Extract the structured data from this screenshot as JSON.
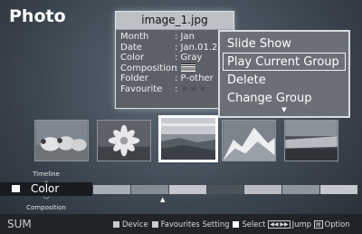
{
  "screen": {
    "title": "Photo"
  },
  "info_panel": {
    "filename": "image_1.jpg",
    "fields": [
      {
        "label": "Month",
        "value": ": Jan"
      },
      {
        "label": "Date",
        "value": ": Jan.01.2"
      },
      {
        "label": "Color",
        "value": ": Gray"
      },
      {
        "label": "Composition",
        "value": ":"
      },
      {
        "label": "Folder",
        "value": ": P-other"
      },
      {
        "label": "Favourite",
        "value": ":"
      }
    ],
    "favourite_stars": "★★★"
  },
  "menu": {
    "items": [
      {
        "label": "Slide Show",
        "selected": false
      },
      {
        "label": "Play Current Group",
        "selected": true
      },
      {
        "label": "Delete",
        "selected": false
      },
      {
        "label": "Change Group",
        "selected": false
      }
    ],
    "more_indicator": "▼"
  },
  "thumbnails": [
    {
      "icon": "sheep-photo",
      "selected": false
    },
    {
      "icon": "flower-photo",
      "selected": false
    },
    {
      "icon": "coast-photo",
      "selected": true
    },
    {
      "icon": "mountain-photo",
      "selected": false
    },
    {
      "icon": "landscape-photo",
      "selected": false
    }
  ],
  "sort_bar": {
    "prev_label": "Timeline",
    "current_label": "Color",
    "next_label": "Composition",
    "up_arrow": "︿",
    "down_arrow": "﹀",
    "position_marker": "▲",
    "segment_colors": [
      "#a9aeb4",
      "#868c93",
      "#c3c7cc",
      "#4d535b",
      "#b9bdc2",
      "#8f959c",
      "#c4c8cd"
    ]
  },
  "bottom_bar": {
    "sum_label": "SUM",
    "device_label": "Device",
    "favourites_label": "Favourites Setting",
    "select_label": "Select",
    "jump_keys": "◀◀ ▶▶",
    "jump_label": "Jump",
    "option_label": "Option"
  }
}
